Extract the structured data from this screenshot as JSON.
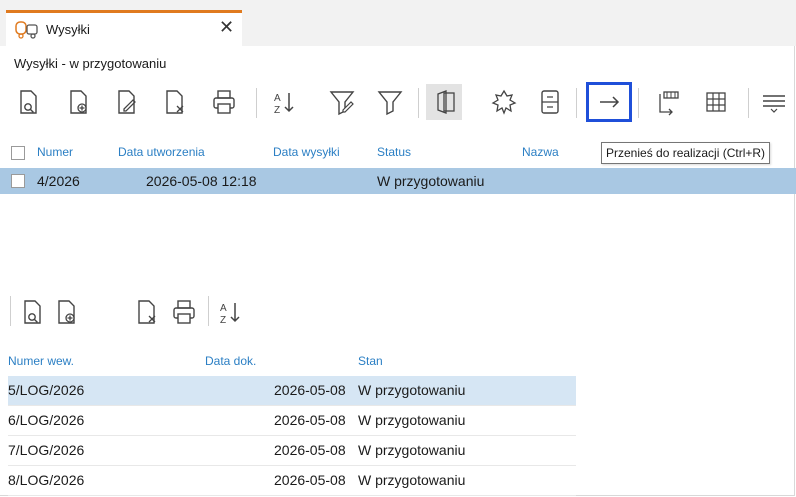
{
  "tab": {
    "title": "Wysyłki",
    "close": "✕"
  },
  "subtitle": "Wysyłki - w przygotowaniu",
  "tooltip": "Przenieś do realizacji (Ctrl+R)",
  "grid1": {
    "columns": [
      "Numer",
      "Data utworzenia",
      "Data wysyłki",
      "Status",
      "Nazwa"
    ],
    "rows": [
      {
        "numer": "4/2026",
        "data_utworzenia": "2026-05-08 12:18",
        "data_wysylki": "",
        "status": "W przygotowaniu",
        "nazwa": ""
      }
    ]
  },
  "grid2": {
    "columns": [
      "Numer wew.",
      "Data dok.",
      "Stan"
    ],
    "rows": [
      {
        "numer": "5/LOG/2026",
        "data": "2026-05-08",
        "stan": "W przygotowaniu"
      },
      {
        "numer": "6/LOG/2026",
        "data": "2026-05-08",
        "stan": "W przygotowaniu"
      },
      {
        "numer": "7/LOG/2026",
        "data": "2026-05-08",
        "stan": "W przygotowaniu"
      },
      {
        "numer": "8/LOG/2026",
        "data": "2026-05-08",
        "stan": "W przygotowaniu"
      }
    ]
  },
  "colors": {
    "accent": "#e07a1f",
    "header_text": "#2b7fc4",
    "selected_row": "#a9c8e3",
    "focus_border": "#1f4fd9"
  }
}
